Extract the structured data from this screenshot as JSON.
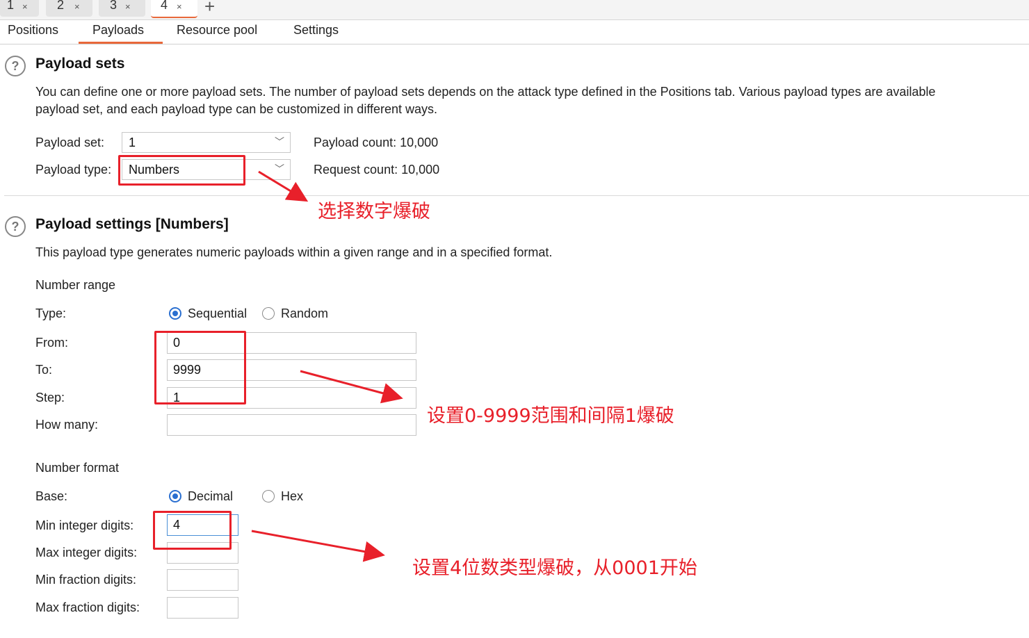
{
  "instance_tabs": [
    {
      "label": "1",
      "close": "×"
    },
    {
      "label": "2",
      "close": "×"
    },
    {
      "label": "3",
      "close": "×"
    },
    {
      "label": "4",
      "close": "×"
    }
  ],
  "new_tab_label": "+",
  "subtabs": [
    "Positions",
    "Payloads",
    "Resource pool",
    "Settings"
  ],
  "active_subtab": "Payloads",
  "help_glyph": "?",
  "payload_sets": {
    "title": "Payload sets",
    "description_line1": "You can define one or more payload sets. The number of payload sets depends on the attack type defined in the Positions tab. Various payload types are available",
    "description_line2": "payload set, and each payload type can be customized in different ways.",
    "payload_set_label": "Payload set:",
    "payload_set_value": "1",
    "payload_type_label": "Payload type:",
    "payload_type_value": "Numbers",
    "payload_count": "Payload count: 10,000",
    "request_count": "Request count: 10,000"
  },
  "payload_settings": {
    "title": "Payload settings [Numbers]",
    "description": "This payload type generates numeric payloads within a given range and in a specified format.",
    "number_range_heading": "Number range",
    "type_label": "Type:",
    "type_options": [
      "Sequential",
      "Random"
    ],
    "type_selected": "Sequential",
    "from_label": "From:",
    "from_value": "0",
    "to_label": "To:",
    "to_value": "9999",
    "step_label": "Step:",
    "step_value": "1",
    "how_many_label": "How many:",
    "how_many_value": "",
    "number_format_heading": "Number format",
    "base_label": "Base:",
    "base_options": [
      "Decimal",
      "Hex"
    ],
    "base_selected": "Decimal",
    "min_int_label": "Min integer digits:",
    "min_int_value": "4",
    "max_int_label": "Max integer digits:",
    "max_int_value": "",
    "min_frac_label": "Min fraction digits:",
    "min_frac_value": "",
    "max_frac_label": "Max fraction digits:",
    "max_frac_value": ""
  },
  "annotations": {
    "select_numbers": "选择数字爆破",
    "range_note": "设置0-9999范围和间隔1爆破",
    "digits_note": "设置4位数类型爆破，从0001开始"
  },
  "colors": {
    "accent_orange": "#e8683a",
    "annotation_red": "#e8202a",
    "radio_blue": "#2a6fd0"
  },
  "icons": {
    "dropdown": "chevron-down-icon",
    "help": "help-circle-icon",
    "close_tab": "close-icon",
    "new_tab": "plus-icon"
  }
}
